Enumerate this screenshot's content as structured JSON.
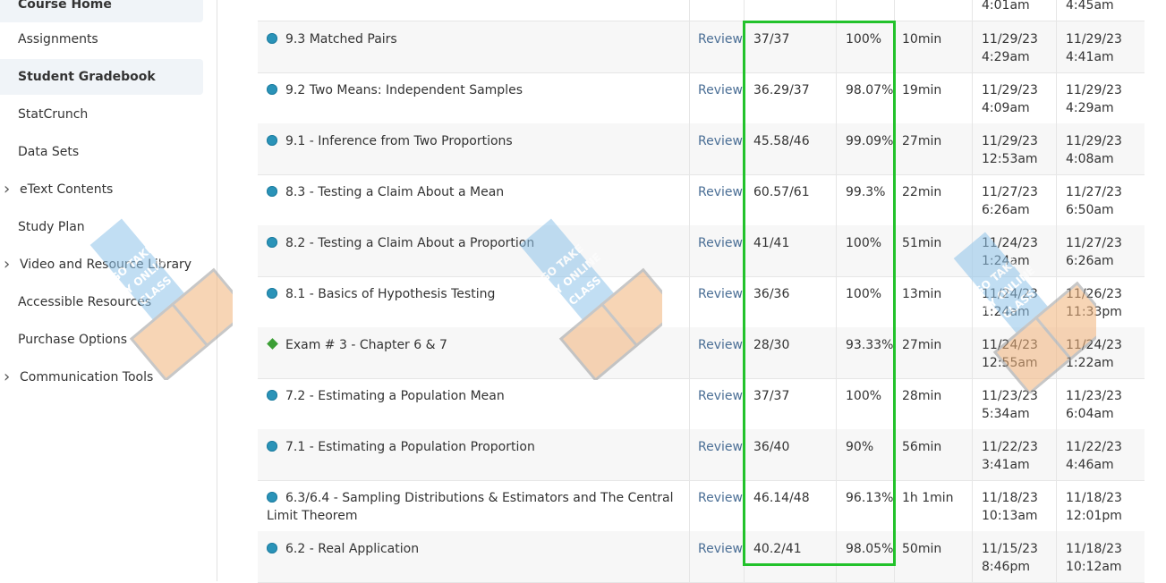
{
  "sidebar": {
    "items": [
      {
        "label": "Course Home",
        "active": true,
        "expandable": false
      },
      {
        "label": "Assignments",
        "active": false,
        "expandable": false
      },
      {
        "label": "Student Gradebook",
        "active": true,
        "expandable": false
      },
      {
        "label": "StatCrunch",
        "active": false,
        "expandable": false
      },
      {
        "label": "Data Sets",
        "active": false,
        "expandable": false
      },
      {
        "label": "eText Contents",
        "active": false,
        "expandable": true
      },
      {
        "label": "Study Plan",
        "active": false,
        "expandable": false
      },
      {
        "label": "Video and Resource Library",
        "active": false,
        "expandable": true
      },
      {
        "label": "Accessible Resources",
        "active": false,
        "expandable": false
      },
      {
        "label": "Purchase Options",
        "active": false,
        "expandable": false
      },
      {
        "label": "Communication Tools",
        "active": false,
        "expandable": true
      }
    ]
  },
  "top_partial": {
    "start_time": "4:01am",
    "end_time": "4:45am"
  },
  "rows": [
    {
      "icon": "circle-icon",
      "name": "9.3 Matched Pairs",
      "review": "Review",
      "score": "37/37",
      "percent": "100%",
      "time": "10min",
      "start_date": "11/29/23",
      "start_time": "4:29am",
      "end_date": "11/29/23",
      "end_time": "4:41am"
    },
    {
      "icon": "circle-icon",
      "name": "9.2 Two Means: Independent Samples",
      "review": "Review",
      "score": "36.29/37",
      "percent": "98.07%",
      "time": "19min",
      "start_date": "11/29/23",
      "start_time": "4:09am",
      "end_date": "11/29/23",
      "end_time": "4:29am"
    },
    {
      "icon": "circle-icon",
      "name": "9.1 - Inference from Two Proportions",
      "review": "Review",
      "score": "45.58/46",
      "percent": "99.09%",
      "time": "27min",
      "start_date": "11/29/23",
      "start_time": "12:53am",
      "end_date": "11/29/23",
      "end_time": "4:08am"
    },
    {
      "icon": "circle-icon",
      "name": "8.3 - Testing a Claim About a Mean",
      "review": "Review",
      "score": "60.57/61",
      "percent": "99.3%",
      "time": "22min",
      "start_date": "11/27/23",
      "start_time": "6:26am",
      "end_date": "11/27/23",
      "end_time": "6:50am"
    },
    {
      "icon": "circle-icon",
      "name": "8.2 - Testing a Claim About a Proportion",
      "review": "Review",
      "score": "41/41",
      "percent": "100%",
      "time": "51min",
      "start_date": "11/24/23",
      "start_time": "1:24am",
      "end_date": "11/27/23",
      "end_time": "6:26am"
    },
    {
      "icon": "circle-icon",
      "name": "8.1 - Basics of Hypothesis Testing",
      "review": "Review",
      "score": "36/36",
      "percent": "100%",
      "time": "13min",
      "start_date": "11/24/23",
      "start_time": "1:24am",
      "end_date": "11/26/23",
      "end_time": "11:33pm"
    },
    {
      "icon": "diamond-icon",
      "name": "Exam # 3 - Chapter 6 & 7",
      "review": "Review",
      "score": "28/30",
      "percent": "93.33%",
      "time": "27min",
      "start_date": "11/24/23",
      "start_time": "12:55am",
      "end_date": "11/24/23",
      "end_time": "1:22am"
    },
    {
      "icon": "circle-icon",
      "name": "7.2 - Estimating a Population Mean",
      "review": "Review",
      "score": "37/37",
      "percent": "100%",
      "time": "28min",
      "start_date": "11/23/23",
      "start_time": "5:34am",
      "end_date": "11/23/23",
      "end_time": "6:04am"
    },
    {
      "icon": "circle-icon",
      "name": "7.1 - Estimating a Population Proportion",
      "review": "Review",
      "score": "36/40",
      "percent": "90%",
      "time": "56min",
      "start_date": "11/22/23",
      "start_time": "3:41am",
      "end_date": "11/22/23",
      "end_time": "4:46am"
    },
    {
      "icon": "circle-icon",
      "name": "6.3/6.4 - Sampling Distributions & Estimators and The Central Limit Theorem",
      "review": "Review",
      "score": "46.14/48",
      "percent": "96.13%",
      "time": "1h 1min",
      "start_date": "11/18/23",
      "start_time": "10:13am",
      "end_date": "11/18/23",
      "end_time": "12:01pm"
    },
    {
      "icon": "circle-icon",
      "name": "6.2 - Real Application",
      "review": "Review",
      "score": "40.2/41",
      "percent": "98.05%",
      "time": "50min",
      "start_date": "11/15/23",
      "start_time": "8:46pm",
      "end_date": "11/18/23",
      "end_time": "10:12am"
    }
  ],
  "watermark": {
    "line1": "GO TAKE",
    "line2": "MY ONLINE",
    "line3": "CLASS"
  },
  "colors": {
    "highlight": "#22c22b",
    "link": "#4a6e95",
    "dot": "#2a93b8",
    "diamond": "#3b9e35"
  }
}
